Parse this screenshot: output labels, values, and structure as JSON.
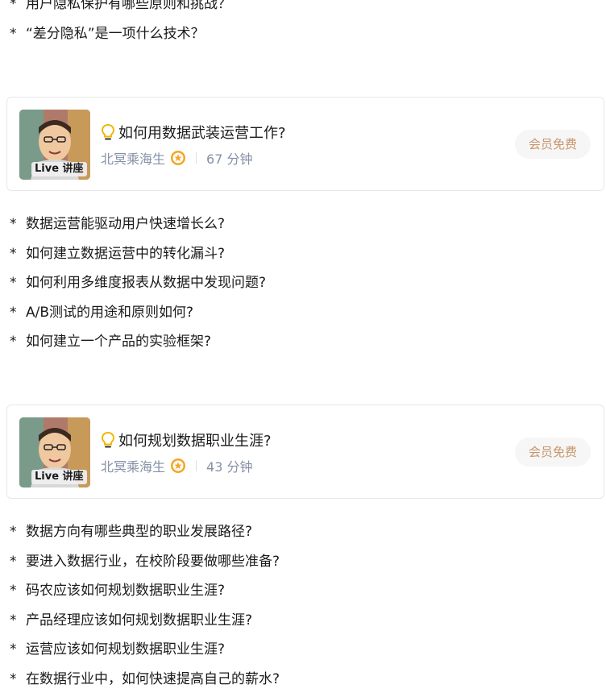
{
  "top_list": {
    "items": [
      "用户隐私保护有哪些原则和挑战？",
      "“差分隐私”是一项什么技术？"
    ]
  },
  "cards": [
    {
      "title": "如何用数据武装运营工作?",
      "author": "北冥乘海生",
      "duration": "67 分钟",
      "tag": "Live 讲座",
      "action": "会员免费",
      "questions": [
        "数据运营能驱动用户快速增长么?",
        "如何建立数据运营中的转化漏斗?",
        "如何利用多维度报表从数据中发现问题?",
        "A/B测试的用途和原则如何?",
        "如何建立一个产品的实验框架?"
      ]
    },
    {
      "title": "如何规划数据职业生涯?",
      "author": "北冥乘海生",
      "duration": "43 分钟",
      "tag": "Live 讲座",
      "action": "会员免费",
      "questions": [
        "数据方向有哪些典型的职业发展路径?",
        "要进入数据行业，在校阶段要做哪些准备?",
        "码农应该如何规划数据职业生涯?",
        "产品经理应该如何规划数据职业生涯?",
        "运营应该如何规划数据职业生涯?",
        "在数据行业中，如何快速提高自己的薪水?"
      ]
    }
  ],
  "bullet_symbol": "*",
  "icons": {
    "title_icon": "lightbulb-icon",
    "author_badge": "verified-badge-icon"
  },
  "colors": {
    "accent": "#c8956b",
    "meta": "#8590a6",
    "badge": "#f5a623"
  }
}
